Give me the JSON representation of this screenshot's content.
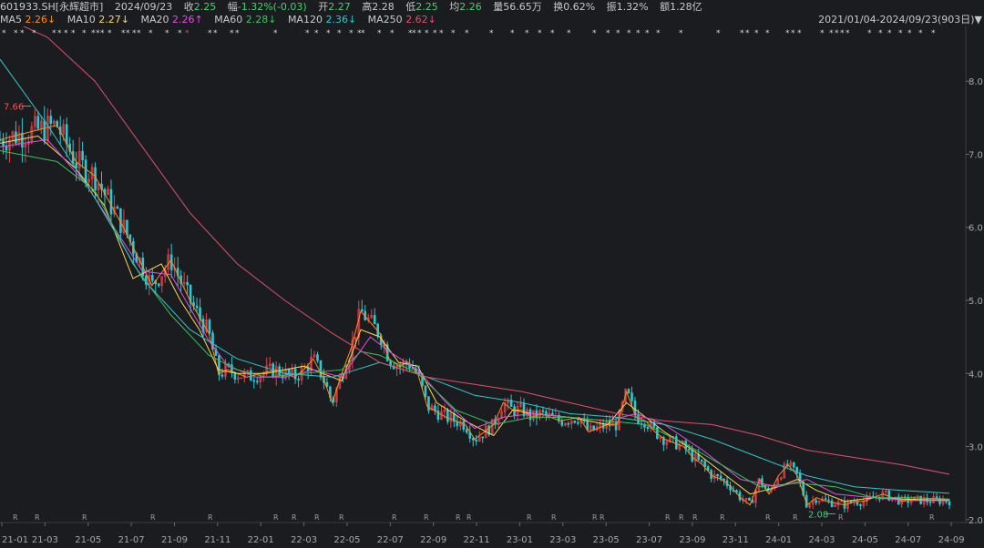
{
  "header": {
    "symbol": "601933.SH[永辉超市]",
    "date": "2024/09/23",
    "close_label": "收",
    "close": "2.25",
    "change_label": "幅",
    "change": "-1.32%(-0.03)",
    "open_label": "开",
    "open": "2.27",
    "high_label": "高",
    "high": "2.28",
    "low_label": "低",
    "low": "2.25",
    "avg_label": "均",
    "avg": "2.26",
    "vol_label": "量",
    "vol": "56.65万",
    "turnover_label": "换",
    "turnover": "0.62%",
    "amp_label": "振",
    "amp": "1.32%",
    "amount_label": "额",
    "amount": "1.28亿",
    "range": "2021/01/04-2024/09/23(903日)"
  },
  "ma": [
    {
      "label": "MA5",
      "value": "2.26↓",
      "color": "#ff8c1a"
    },
    {
      "label": "MA10",
      "value": "2.27↓",
      "color": "#ffd84d"
    },
    {
      "label": "MA20",
      "value": "2.26↑",
      "color": "#e050e0"
    },
    {
      "label": "MA60",
      "value": "2.28↓",
      "color": "#35c35a"
    },
    {
      "label": "MA120",
      "value": "2.36↓",
      "color": "#2ec7c9"
    },
    {
      "label": "MA250",
      "value": "2.62↓",
      "color": "#e0506b"
    }
  ],
  "colors": {
    "up": "#e8434a",
    "down": "#2cc9d4",
    "up_text": "#ff4d4f",
    "down_text": "#3fd36e",
    "bg": "#1b1c20"
  },
  "chart_data": {
    "type": "line",
    "title": "",
    "y_ticks": [
      "8.0",
      "7.0",
      "6.0",
      "5.0",
      "4.0",
      "3.0",
      "2.0"
    ],
    "x_ticks": [
      "21-01",
      "21-03",
      "21-05",
      "21-07",
      "21-09",
      "21-11",
      "22-01",
      "22-03",
      "22-05",
      "22-07",
      "22-09",
      "22-11",
      "23-01",
      "23-03",
      "23-05",
      "23-07",
      "23-09",
      "23-11",
      "24-01",
      "24-03",
      "24-05",
      "24-07",
      "24-09"
    ],
    "ylim": [
      1.96,
      8.75
    ],
    "annotations": {
      "max": "7.66",
      "min": "2.08"
    },
    "series": [
      {
        "name": "MA5",
        "x": [
          0,
          3,
          6,
          8,
          10,
          13,
          16,
          18,
          20,
          22,
          23,
          24,
          26,
          29,
          30,
          31,
          32,
          33,
          34,
          35,
          36,
          37,
          38,
          40,
          41,
          42,
          43,
          44,
          45,
          47,
          49,
          50,
          51,
          52,
          53,
          54,
          55,
          56,
          57,
          59,
          61,
          62,
          64,
          65,
          66,
          67,
          68,
          69,
          70,
          71,
          72,
          73,
          74,
          75,
          76,
          77,
          78,
          79,
          80,
          81,
          82,
          83,
          84,
          85,
          86,
          87,
          89,
          90,
          91,
          92,
          93,
          94,
          95,
          96,
          98,
          100
        ],
        "y": [
          7.2,
          7.3,
          7.4,
          6.9,
          6.7,
          6.0,
          5.2,
          5.55,
          5.0,
          4.55,
          4.0,
          4.05,
          3.95,
          4.05,
          4.0,
          3.95,
          4.05,
          4.2,
          3.95,
          3.6,
          4.0,
          4.35,
          4.85,
          4.55,
          4.2,
          4.1,
          4.15,
          4.0,
          3.55,
          3.4,
          3.3,
          3.1,
          3.2,
          3.3,
          3.6,
          3.5,
          3.5,
          3.4,
          3.45,
          3.35,
          3.4,
          3.2,
          3.3,
          3.3,
          3.75,
          3.4,
          3.35,
          3.2,
          3.1,
          3.05,
          3.0,
          2.85,
          2.75,
          2.6,
          2.55,
          2.45,
          2.3,
          2.2,
          2.55,
          2.35,
          2.6,
          2.75,
          2.6,
          2.2,
          2.3,
          2.25,
          2.2,
          2.25,
          2.25,
          2.3,
          2.35,
          2.3,
          2.25,
          2.27,
          2.26,
          2.26
        ]
      },
      {
        "name": "MA10",
        "x": [
          0,
          4,
          8,
          11,
          14,
          17,
          19,
          21,
          23,
          25,
          28,
          32,
          34,
          36,
          38,
          40,
          42,
          44,
          46,
          49,
          52,
          54,
          56,
          60,
          64,
          66,
          68,
          70,
          73,
          76,
          79,
          82,
          84,
          86,
          89,
          92,
          95,
          98,
          100
        ],
        "y": [
          7.15,
          7.25,
          6.8,
          6.3,
          5.3,
          5.5,
          5.0,
          4.6,
          4.05,
          4.0,
          4.0,
          4.1,
          4.0,
          3.9,
          4.6,
          4.5,
          4.15,
          4.1,
          3.6,
          3.35,
          3.15,
          3.5,
          3.45,
          3.4,
          3.3,
          3.6,
          3.4,
          3.2,
          2.95,
          2.65,
          2.35,
          2.45,
          2.55,
          2.4,
          2.25,
          2.3,
          2.28,
          2.27,
          2.27
        ]
      },
      {
        "name": "MA20",
        "x": [
          0,
          5,
          9,
          12,
          15,
          18,
          20,
          22,
          24,
          27,
          30,
          33,
          36,
          39,
          41,
          44,
          47,
          50,
          53,
          56,
          60,
          64,
          67,
          70,
          74,
          78,
          82,
          85,
          88,
          92,
          96,
          100
        ],
        "y": [
          7.1,
          7.2,
          6.6,
          6.0,
          5.4,
          5.35,
          4.9,
          4.45,
          4.1,
          3.95,
          3.95,
          4.05,
          3.95,
          4.5,
          4.3,
          4.05,
          3.6,
          3.25,
          3.4,
          3.45,
          3.4,
          3.35,
          3.45,
          3.3,
          2.95,
          2.55,
          2.45,
          2.55,
          2.35,
          2.3,
          2.26,
          2.26
        ]
      },
      {
        "name": "MA60",
        "x": [
          0,
          6,
          10,
          14,
          18,
          22,
          25,
          28,
          32,
          36,
          38,
          40,
          44,
          48,
          52,
          56,
          60,
          64,
          68,
          72,
          76,
          80,
          84,
          88,
          92,
          96,
          100
        ],
        "y": [
          7.05,
          6.9,
          6.5,
          5.5,
          4.8,
          4.25,
          4.05,
          3.95,
          4.0,
          4.05,
          4.3,
          4.25,
          4.0,
          3.5,
          3.3,
          3.4,
          3.4,
          3.35,
          3.3,
          3.05,
          2.75,
          2.45,
          2.5,
          2.45,
          2.3,
          2.3,
          2.28
        ]
      },
      {
        "name": "MA120",
        "x": [
          0,
          5,
          10,
          15,
          20,
          25,
          30,
          35,
          40,
          45,
          50,
          55,
          60,
          65,
          70,
          75,
          80,
          85,
          90,
          95,
          100
        ],
        "y": [
          8.3,
          7.4,
          6.4,
          5.3,
          4.6,
          4.2,
          4.0,
          3.95,
          4.15,
          3.95,
          3.7,
          3.6,
          3.45,
          3.4,
          3.3,
          3.1,
          2.85,
          2.6,
          2.45,
          2.4,
          2.36
        ]
      },
      {
        "name": "MA250",
        "x": [
          0,
          5,
          10,
          15,
          20,
          25,
          30,
          35,
          40,
          45,
          50,
          55,
          60,
          65,
          70,
          75,
          80,
          85,
          90,
          95,
          100
        ],
        "y": [
          8.9,
          8.6,
          8.0,
          7.1,
          6.2,
          5.5,
          5.0,
          4.55,
          4.15,
          3.95,
          3.85,
          3.75,
          3.6,
          3.45,
          3.35,
          3.3,
          3.15,
          2.95,
          2.85,
          2.75,
          2.62
        ]
      }
    ]
  }
}
